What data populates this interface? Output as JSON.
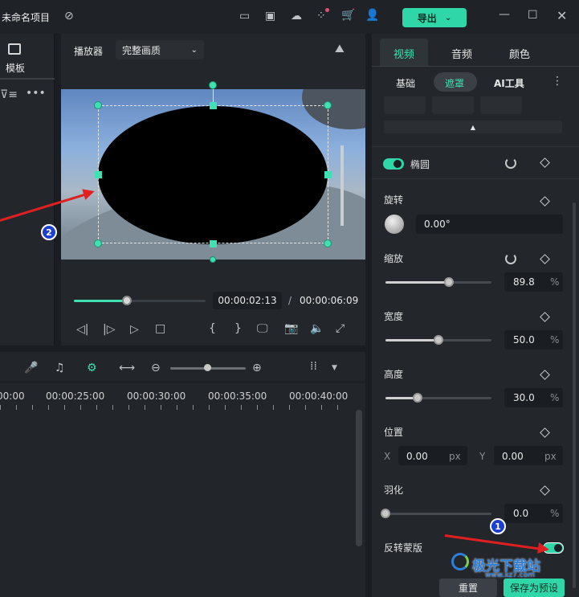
{
  "titlebar": {
    "project_title": "未命名项目",
    "export_label": "导出"
  },
  "leftpanel": {
    "template_label": "模板"
  },
  "player": {
    "label": "播放器",
    "quality": "完整画质",
    "current_time": "00:00:02:13",
    "separator": "/",
    "total_time": "00:00:06:09",
    "progress": 0.4
  },
  "timeline": {
    "ticks": [
      "00:00",
      "00:00:25:00",
      "00:00:30:00",
      "00:00:35:00",
      "00:00:40:00"
    ]
  },
  "tabs": {
    "video": "视频",
    "audio": "音频",
    "color": "颜色"
  },
  "subtabs": {
    "basic": "基础",
    "mask": "遮罩",
    "ai_tools": "AI工具"
  },
  "mask": {
    "shape_name": "椭圆"
  },
  "rotation": {
    "label": "旋转",
    "value": "0.00°"
  },
  "scale": {
    "label": "缩放",
    "value": "89.8",
    "unit": "%",
    "level": 0.6
  },
  "width": {
    "label": "宽度",
    "value": "50.0",
    "unit": "%",
    "level": 0.5
  },
  "height": {
    "label": "高度",
    "value": "30.0",
    "unit": "%",
    "level": 0.3
  },
  "position": {
    "label": "位置",
    "x_label": "X",
    "x_value": "0.00",
    "x_unit": "px",
    "y_label": "Y",
    "y_value": "0.00",
    "y_unit": "px"
  },
  "feather": {
    "label": "羽化",
    "value": "0.0",
    "unit": "%",
    "level": 0.0
  },
  "invert": {
    "label": "反转蒙版",
    "on": true
  },
  "footer": {
    "reset_label": "重置",
    "save_preset_label": "保存为预设"
  },
  "annotations": {
    "badge1": "1",
    "badge2": "2"
  },
  "watermark": {
    "text": "极光下载站",
    "url": "www.xz7.com"
  },
  "colors": {
    "accent": "#2fd6a8",
    "arrow": "#e02020",
    "badge": "#1d3fcf"
  }
}
